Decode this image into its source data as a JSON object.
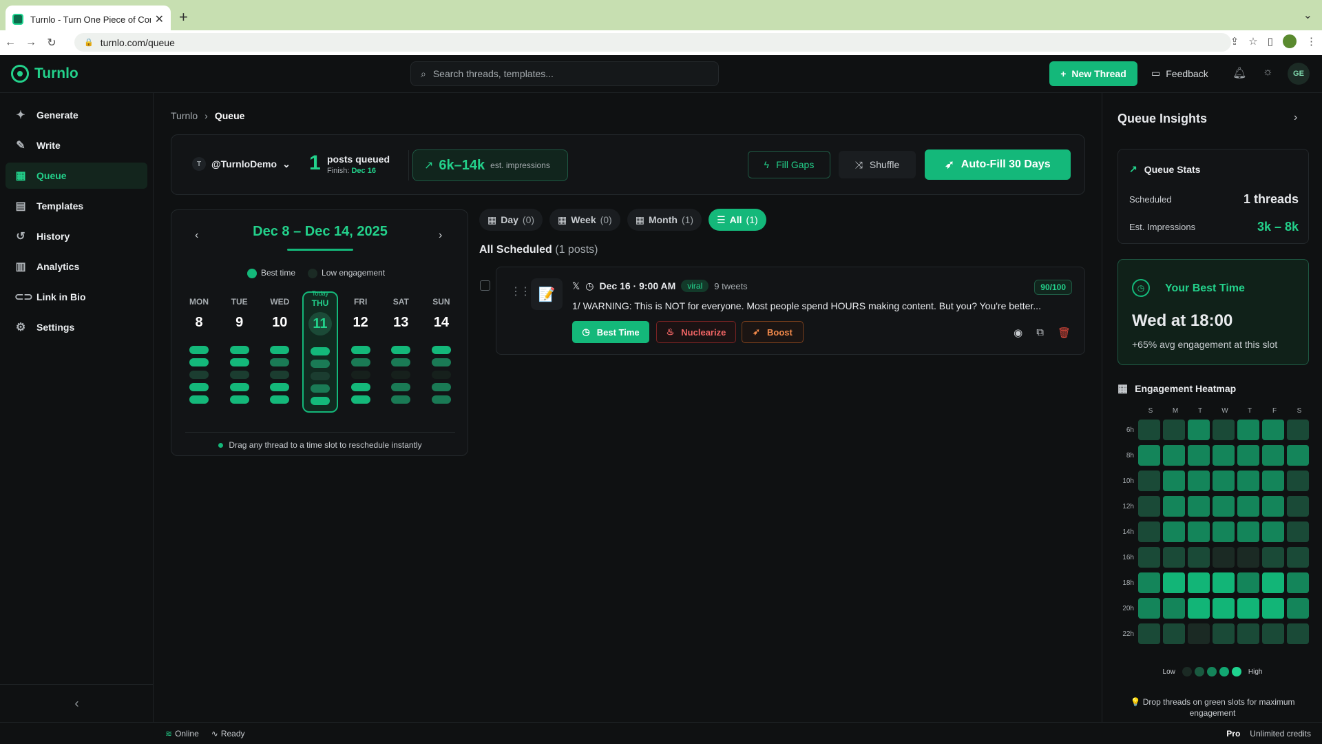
{
  "browser": {
    "tab_title": "Turnlo - Turn One Piece of Con",
    "url": "turnlo.com/queue"
  },
  "topbar": {
    "brand": "Turnlo",
    "search_placeholder": "Search threads, templates...",
    "new_thread": "New Thread",
    "feedback": "Feedback",
    "avatar_initials": "GE"
  },
  "sidebar": {
    "items": [
      {
        "label": "Generate",
        "icon": "sparkles-icon"
      },
      {
        "label": "Write",
        "icon": "pen-icon"
      },
      {
        "label": "Queue",
        "icon": "calendar-icon",
        "active": true
      },
      {
        "label": "Templates",
        "icon": "layout-icon"
      },
      {
        "label": "History",
        "icon": "history-icon"
      },
      {
        "label": "Analytics",
        "icon": "bar-chart-icon"
      },
      {
        "label": "Link in Bio",
        "icon": "link-icon"
      },
      {
        "label": "Settings",
        "icon": "gear-icon"
      }
    ]
  },
  "breadcrumb": {
    "root": "Turnlo",
    "current": "Queue"
  },
  "header": {
    "account_initial": "T",
    "account": "@TurnloDemo",
    "queued_count": "1",
    "queued_label": "posts queued",
    "finish_label": "Finish:",
    "finish_date": "Dec 16",
    "impressions_range": "6k–14k",
    "impressions_label": "est. impressions",
    "fill_gaps": "Fill Gaps",
    "shuffle": "Shuffle",
    "auto_fill": "Auto-Fill 30 Days"
  },
  "calendar": {
    "range": "Dec 8 – Dec 14, 2025",
    "legend_best": "Best time",
    "legend_low": "Low engagement",
    "today_label": "Today",
    "days": [
      {
        "name": "MON",
        "num": "8",
        "slots": [
          3,
          3,
          1,
          3,
          3
        ]
      },
      {
        "name": "TUE",
        "num": "9",
        "slots": [
          3,
          3,
          1,
          3,
          3
        ]
      },
      {
        "name": "WED",
        "num": "10",
        "slots": [
          3,
          2,
          1,
          3,
          3
        ]
      },
      {
        "name": "THU",
        "num": "11",
        "slots": [
          3,
          2,
          1,
          2,
          3
        ],
        "today": true
      },
      {
        "name": "FRI",
        "num": "12",
        "slots": [
          3,
          2,
          0,
          3,
          3
        ]
      },
      {
        "name": "SAT",
        "num": "13",
        "slots": [
          3,
          2,
          0,
          2,
          2
        ]
      },
      {
        "name": "SUN",
        "num": "14",
        "slots": [
          3,
          2,
          0,
          2,
          2
        ]
      }
    ],
    "hint": "Drag any thread to a time slot to reschedule instantly"
  },
  "filters": [
    {
      "label": "Day",
      "count": "(0)",
      "icon": "calendar-icon"
    },
    {
      "label": "Week",
      "count": "(0)",
      "icon": "calendar-icon"
    },
    {
      "label": "Month",
      "count": "(1)",
      "icon": "calendar-icon"
    },
    {
      "label": "All",
      "count": "(1)",
      "icon": "list-icon",
      "active": true
    }
  ],
  "scheduled": {
    "title": "All Scheduled",
    "count": "(1 posts)"
  },
  "post": {
    "date": "Dec 16 · 9:00 AM",
    "badge": "viral",
    "tweets": "9 tweets",
    "score": "90/100",
    "text": "1/ WARNING: This is NOT for everyone. Most people spend HOURS making content. But you? You're better...",
    "best_time": "Best Time",
    "nuclearize": "Nuclearize",
    "boost": "Boost"
  },
  "insights": {
    "title": "Queue Insights",
    "stats_title": "Queue Stats",
    "scheduled_label": "Scheduled",
    "scheduled_value": "1 threads",
    "impr_label": "Est. Impressions",
    "impr_value": "3k – 8k",
    "best_title": "Your Best Time",
    "best_value": "Wed at 18:00",
    "best_sub": "+65% avg engagement at this slot",
    "heatmap_title": "Engagement Heatmap",
    "heat_days": [
      "S",
      "M",
      "T",
      "W",
      "T",
      "F",
      "S"
    ],
    "heat_rows": [
      {
        "label": "6h",
        "v": [
          1,
          1,
          2,
          1,
          2,
          2,
          1
        ]
      },
      {
        "label": "8h",
        "v": [
          2,
          2,
          2,
          2,
          2,
          2,
          2
        ]
      },
      {
        "label": "10h",
        "v": [
          1,
          2,
          2,
          2,
          2,
          2,
          1
        ]
      },
      {
        "label": "12h",
        "v": [
          1,
          2,
          2,
          2,
          2,
          2,
          1
        ]
      },
      {
        "label": "14h",
        "v": [
          1,
          2,
          2,
          2,
          2,
          2,
          1
        ]
      },
      {
        "label": "16h",
        "v": [
          1,
          1,
          1,
          0,
          0,
          1,
          1
        ]
      },
      {
        "label": "18h",
        "v": [
          2,
          3,
          3,
          3,
          2,
          3,
          2
        ]
      },
      {
        "label": "20h",
        "v": [
          2,
          2,
          3,
          3,
          3,
          3,
          2
        ]
      },
      {
        "label": "22h",
        "v": [
          1,
          1,
          0,
          1,
          1,
          1,
          1
        ]
      }
    ],
    "legend_low": "Low",
    "legend_high": "High",
    "tip": "Drop threads on green slots for maximum engagement"
  },
  "status": {
    "online": "Online",
    "ready": "Ready",
    "plan": "Pro",
    "credits": "Unlimited credits"
  },
  "colors": {
    "accent": "#14b87a",
    "accent_text": "#23d18b",
    "danger": "#f26565",
    "warn": "#f38a4b"
  }
}
